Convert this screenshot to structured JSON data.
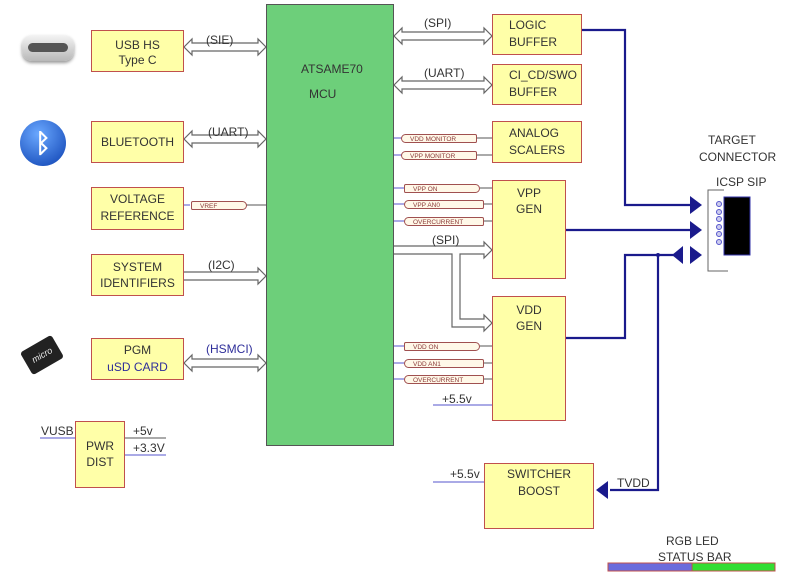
{
  "mcu": {
    "name": "ATSAME70",
    "type": "MCU"
  },
  "left_blocks": [
    {
      "id": "usb",
      "line1": "USB HS",
      "line2": "Type C",
      "bus": "(SIE)",
      "icon": "usb-c-connector-icon"
    },
    {
      "id": "bluetooth",
      "line1": "BLUETOOTH",
      "line2": "",
      "bus": "(UART)",
      "icon": "bluetooth-icon"
    },
    {
      "id": "vref",
      "line1": "VOLTAGE",
      "line2": "REFERENCE",
      "port": "VREF"
    },
    {
      "id": "sysid",
      "line1": "SYSTEM",
      "line2": "IDENTIFIERS",
      "bus": "(I2C)"
    },
    {
      "id": "sdcard",
      "line1": "PGM",
      "line2": "uSD CARD",
      "bus": "(HSMCI)",
      "icon": "micro-sd-card-icon"
    }
  ],
  "pwr_dist": {
    "line1": "PWR",
    "line2": "DIST",
    "input": "VUSB",
    "out1": "+5v",
    "out2": "+3.3V"
  },
  "right_blocks": {
    "logic_buffer": {
      "line1": "LOGIC",
      "line2": "BUFFER",
      "bus": "(SPI)"
    },
    "swo_buffer": {
      "line1": "CI_CD/SWO",
      "line2": "BUFFER",
      "bus": "(UART)"
    },
    "analog_scalers": {
      "line1": "ANALOG",
      "line2": "SCALERS",
      "ports": [
        "VDD MONITOR",
        "VPP MONITOR"
      ]
    },
    "vpp_gen": {
      "line1": "VPP",
      "line2": "GEN",
      "ports": [
        "VPP ON",
        "VPP AN0",
        "OVERCURRENT"
      ]
    },
    "spi_bus": "(SPI)",
    "vdd_gen": {
      "line1": "VDD",
      "line2": "GEN",
      "ports": [
        "VDD ON",
        "VDD AN1",
        "OVERCURRENT"
      ],
      "supply": "+5.5v"
    },
    "switcher": {
      "line1": "SWITCHER",
      "line2": "BOOST",
      "supply": "+5.5v",
      "feedback": "TVDD"
    }
  },
  "target": {
    "line1": "TARGET",
    "line2": "CONNECTOR",
    "connector": "ICSP SIP",
    "pins": 6
  },
  "status_bar": {
    "line1": "RGB LED",
    "line2": "STATUS BAR",
    "colors": [
      "#6b6bdc",
      "#33dd33"
    ]
  },
  "colors": {
    "block_fill": "#ffffa8",
    "block_border": "#c0504d",
    "mcu_fill": "#6dcf7a",
    "net": "#1a1a8c",
    "bus": "#666666"
  }
}
